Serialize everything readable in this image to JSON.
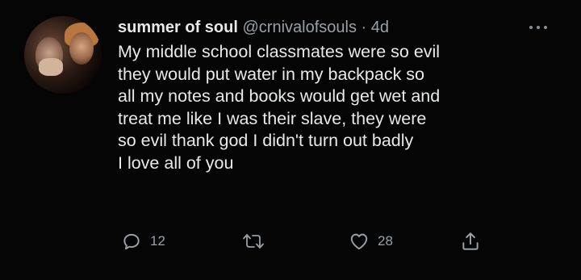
{
  "tweet": {
    "author_name": "summer of soul",
    "author_handle": "@crnivalofsouls",
    "separator": "·",
    "time": "4d",
    "text": "My middle school classmates were so evil\nthey would put water in my backpack so\nall my notes and books would get wet and\ntreat me like I was their slave, they were\nso evil thank god I didn't turn out badly\n I love all of you",
    "more_icon": "more-horizontal-icon"
  },
  "actions": {
    "reply_count": "12",
    "retweet_count": "",
    "like_count": "28",
    "icons": [
      "reply-icon",
      "retweet-icon",
      "like-icon",
      "share-icon"
    ]
  },
  "colors": {
    "background": "#050505",
    "text": "#e7e9ea",
    "secondary": "#9aa0a6"
  }
}
